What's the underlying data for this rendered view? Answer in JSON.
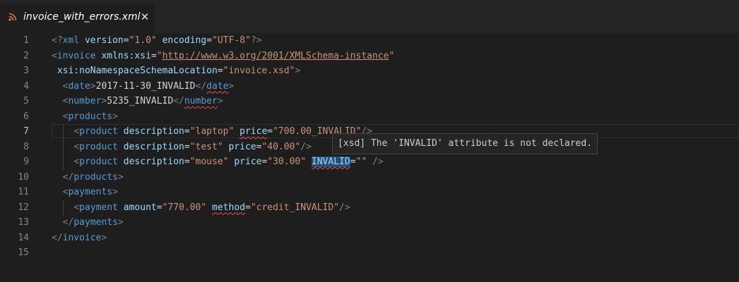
{
  "tab": {
    "title": "invoice_with_errors.xml",
    "icon": "rss-feed-icon",
    "close_glyph": "✕"
  },
  "hover": {
    "message": "[xsd] The 'INVALID' attribute is not declared."
  },
  "editor": {
    "current_line": 7,
    "lines": [
      {
        "n": "1",
        "tokens": [
          {
            "t": "<?",
            "c": "pun"
          },
          {
            "t": "xml",
            "c": "tag"
          },
          {
            "t": " "
          },
          {
            "t": "version",
            "c": "attr"
          },
          {
            "t": "=",
            "c": "txt"
          },
          {
            "t": "\"1.0\"",
            "c": "str"
          },
          {
            "t": " "
          },
          {
            "t": "encoding",
            "c": "attr"
          },
          {
            "t": "=",
            "c": "txt"
          },
          {
            "t": "\"UTF-8\"",
            "c": "str"
          },
          {
            "t": "?>",
            "c": "pun"
          }
        ]
      },
      {
        "n": "2",
        "tokens": [
          {
            "t": "<",
            "c": "pun"
          },
          {
            "t": "invoice",
            "c": "tag"
          },
          {
            "t": " "
          },
          {
            "t": "xmlns:xsi",
            "c": "attr"
          },
          {
            "t": "=",
            "c": "txt"
          },
          {
            "t": "\"",
            "c": "str"
          },
          {
            "t": "http://www.w3.org/2001/XMLSchema-instance",
            "c": "link"
          },
          {
            "t": "\"",
            "c": "str"
          }
        ]
      },
      {
        "n": "3",
        "tokens": [
          {
            "t": " xsi:noNamespaceSchemaLocation",
            "c": "attr"
          },
          {
            "t": "=",
            "c": "txt"
          },
          {
            "t": "\"invoice.xsd\"",
            "c": "str"
          },
          {
            "t": ">",
            "c": "pun"
          }
        ]
      },
      {
        "n": "4",
        "tokens": [
          {
            "t": "  "
          },
          {
            "t": "<",
            "c": "pun"
          },
          {
            "t": "date",
            "c": "tag"
          },
          {
            "t": ">",
            "c": "pun"
          },
          {
            "t": "2017-11-30_INVALID",
            "c": "txt"
          },
          {
            "t": "</",
            "c": "pun"
          },
          {
            "t": "date",
            "c": "tag",
            "err": true
          },
          {
            "t": ">",
            "c": "pun"
          }
        ]
      },
      {
        "n": "5",
        "tokens": [
          {
            "t": "  "
          },
          {
            "t": "<",
            "c": "pun"
          },
          {
            "t": "number",
            "c": "tag"
          },
          {
            "t": ">",
            "c": "pun"
          },
          {
            "t": "5235_INVALID",
            "c": "txt"
          },
          {
            "t": "</",
            "c": "pun"
          },
          {
            "t": "number",
            "c": "tag",
            "err": true
          },
          {
            "t": ">",
            "c": "pun"
          }
        ]
      },
      {
        "n": "6",
        "tokens": [
          {
            "t": "  "
          },
          {
            "t": "<",
            "c": "pun"
          },
          {
            "t": "products",
            "c": "tag"
          },
          {
            "t": ">",
            "c": "pun"
          }
        ]
      },
      {
        "n": "7",
        "tokens": [
          {
            "t": "    "
          },
          {
            "t": "<",
            "c": "pun"
          },
          {
            "t": "product",
            "c": "tag"
          },
          {
            "t": " "
          },
          {
            "t": "description",
            "c": "attr"
          },
          {
            "t": "=",
            "c": "txt"
          },
          {
            "t": "\"laptop\"",
            "c": "str"
          },
          {
            "t": " "
          },
          {
            "t": "price",
            "c": "attr",
            "err": true
          },
          {
            "t": "=",
            "c": "txt"
          },
          {
            "t": "\"700.00_INVALID\"",
            "c": "str"
          },
          {
            "t": "/>",
            "c": "pun"
          }
        ]
      },
      {
        "n": "8",
        "tokens": [
          {
            "t": "    "
          },
          {
            "t": "<",
            "c": "pun"
          },
          {
            "t": "product",
            "c": "tag"
          },
          {
            "t": " "
          },
          {
            "t": "description",
            "c": "attr"
          },
          {
            "t": "=",
            "c": "txt"
          },
          {
            "t": "\"test\"",
            "c": "str"
          },
          {
            "t": " "
          },
          {
            "t": "price",
            "c": "attr"
          },
          {
            "t": "=",
            "c": "txt"
          },
          {
            "t": "\"40.00\"",
            "c": "str"
          },
          {
            "t": "/>",
            "c": "pun"
          }
        ]
      },
      {
        "n": "9",
        "tokens": [
          {
            "t": "    "
          },
          {
            "t": "<",
            "c": "pun"
          },
          {
            "t": "product",
            "c": "tag"
          },
          {
            "t": " "
          },
          {
            "t": "description",
            "c": "attr"
          },
          {
            "t": "=",
            "c": "txt"
          },
          {
            "t": "\"mouse\"",
            "c": "str"
          },
          {
            "t": " "
          },
          {
            "t": "price",
            "c": "attr"
          },
          {
            "t": "=",
            "c": "txt"
          },
          {
            "t": "\"30.00\"",
            "c": "str"
          },
          {
            "t": " "
          },
          {
            "t": "INVALID",
            "c": "attr",
            "err": true,
            "hl": true
          },
          {
            "t": "=",
            "c": "txt"
          },
          {
            "t": "\"\"",
            "c": "str"
          },
          {
            "t": " "
          },
          {
            "t": "/>",
            "c": "pun"
          }
        ]
      },
      {
        "n": "10",
        "tokens": [
          {
            "t": "  "
          },
          {
            "t": "</",
            "c": "pun"
          },
          {
            "t": "products",
            "c": "tag"
          },
          {
            "t": ">",
            "c": "pun"
          }
        ]
      },
      {
        "n": "11",
        "tokens": [
          {
            "t": "  "
          },
          {
            "t": "<",
            "c": "pun"
          },
          {
            "t": "payments",
            "c": "tag"
          },
          {
            "t": ">",
            "c": "pun"
          }
        ]
      },
      {
        "n": "12",
        "tokens": [
          {
            "t": "    "
          },
          {
            "t": "<",
            "c": "pun"
          },
          {
            "t": "payment",
            "c": "tag"
          },
          {
            "t": " "
          },
          {
            "t": "amount",
            "c": "attr"
          },
          {
            "t": "=",
            "c": "txt"
          },
          {
            "t": "\"770.00\"",
            "c": "str"
          },
          {
            "t": " "
          },
          {
            "t": "method",
            "c": "attr",
            "err": true
          },
          {
            "t": "=",
            "c": "txt"
          },
          {
            "t": "\"credit_INVALID\"",
            "c": "str"
          },
          {
            "t": "/>",
            "c": "pun"
          }
        ]
      },
      {
        "n": "13",
        "tokens": [
          {
            "t": "  "
          },
          {
            "t": "</",
            "c": "pun"
          },
          {
            "t": "payments",
            "c": "tag"
          },
          {
            "t": ">",
            "c": "pun"
          }
        ]
      },
      {
        "n": "14",
        "tokens": [
          {
            "t": "</",
            "c": "pun"
          },
          {
            "t": "invoice",
            "c": "tag"
          },
          {
            "t": ">",
            "c": "pun"
          }
        ]
      },
      {
        "n": "15",
        "tokens": []
      }
    ]
  },
  "colors": {
    "background": "#1e1e1e",
    "tag": "#569cd6",
    "attribute": "#9cdcfe",
    "string": "#ce9178",
    "error_squiggle": "#f14c4c"
  }
}
